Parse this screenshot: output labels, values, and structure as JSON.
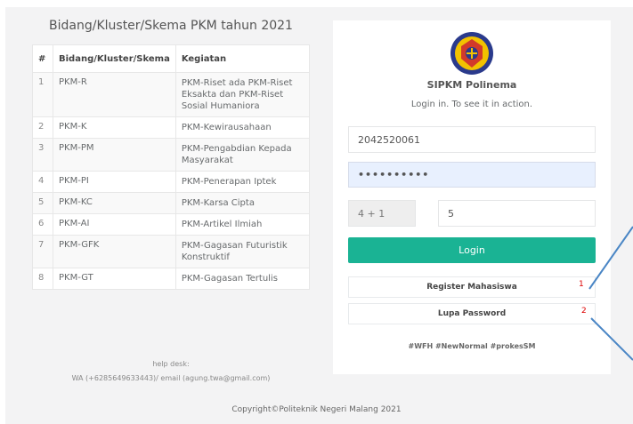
{
  "table": {
    "title": "Bidang/Kluster/Skema PKM tahun 2021",
    "headers": [
      "#",
      "Bidang/Kluster/Skema",
      "Kegiatan"
    ],
    "rows": [
      {
        "no": "1",
        "bidang": "PKM-R",
        "kegiatan": "PKM-Riset ada PKM-Riset Eksakta dan PKM-Riset Sosial Humaniora"
      },
      {
        "no": "2",
        "bidang": "PKM-K",
        "kegiatan": "PKM-Kewirausahaan"
      },
      {
        "no": "3",
        "bidang": "PKM-PM",
        "kegiatan": "PKM-Pengabdian Kepada Masyarakat"
      },
      {
        "no": "4",
        "bidang": "PKM-PI",
        "kegiatan": "PKM-Penerapan Iptek"
      },
      {
        "no": "5",
        "bidang": "PKM-KC",
        "kegiatan": "PKM-Karsa Cipta"
      },
      {
        "no": "6",
        "bidang": "PKM-AI",
        "kegiatan": "PKM-Artikel Ilmiah"
      },
      {
        "no": "7",
        "bidang": "PKM-GFK",
        "kegiatan": "PKM-Gagasan Futuristik Konstruktif"
      },
      {
        "no": "8",
        "bidang": "PKM-GT",
        "kegiatan": "PKM-Gagasan Tertulis"
      }
    ]
  },
  "helpdesk": {
    "label": "help desk:",
    "contact": "WA (+6285649633443)/ email (agung.twa@gmail.com)"
  },
  "footer": {
    "copyright": "Copyright©Politeknik Negeri Malang 2021"
  },
  "login": {
    "app_name": "SIPKM Polinema",
    "subtitle": "Login in. To see it in action.",
    "username_value": "2042520061",
    "password_masked": "••••••••••",
    "captcha_question": "4 + 1",
    "captcha_answer": "5",
    "login_label": "Login",
    "register_label": "Register Mahasiswa",
    "lupa_label": "Lupa Password",
    "hashtags": "#WFH #NewNormal #prokesSM"
  },
  "annotations": {
    "marker_1": "1",
    "marker_2": "2"
  },
  "colors": {
    "accent": "#1ab394",
    "password_bg": "#e8f0fe",
    "marker": "#dd0000",
    "arrow": "#4a86c5"
  },
  "icons": {
    "logo": "polinema-logo-icon"
  }
}
